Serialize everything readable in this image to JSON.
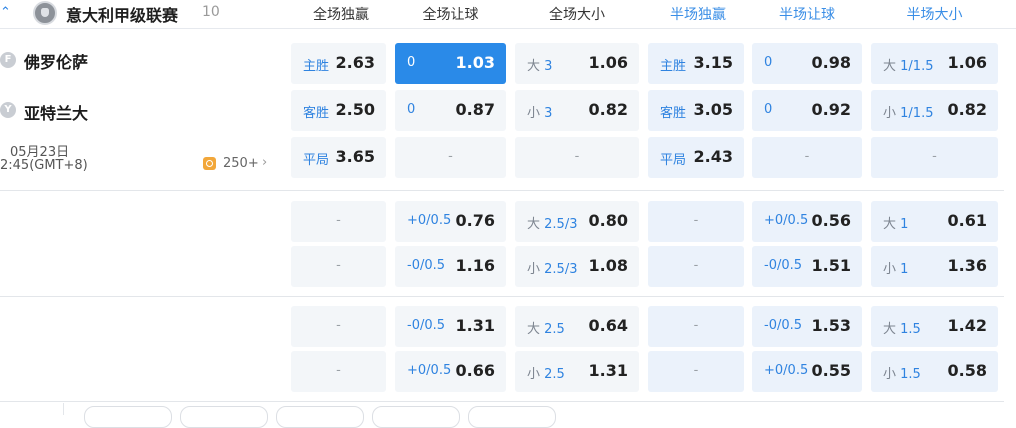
{
  "league": {
    "name": "意大利甲级联赛",
    "count": "10"
  },
  "columns": [
    {
      "label": "全场独赢",
      "color": "#333333"
    },
    {
      "label": "全场让球",
      "color": "#333333"
    },
    {
      "label": "全场大小",
      "color": "#333333"
    },
    {
      "label": "半场独赢",
      "color": "#3a8ee6"
    },
    {
      "label": "半场让球",
      "color": "#3a8ee6"
    },
    {
      "label": "半场大小",
      "color": "#3a8ee6"
    }
  ],
  "match": {
    "home": {
      "badge": "F",
      "name": "佛罗伦萨"
    },
    "away": {
      "badge": "Y",
      "name": "亚特兰大"
    },
    "date": "05月23日",
    "time": "2:45(GMT+8)",
    "more": "250+"
  },
  "rows": [
    [
      {
        "l": "主胜",
        "v": "2.63"
      },
      {
        "l": "0",
        "v": "1.03",
        "hl": true
      },
      {
        "l": "大 3",
        "v": "1.06"
      },
      {
        "l": "主胜",
        "v": "3.15"
      },
      {
        "l": "0",
        "v": "0.98"
      },
      {
        "l": "大 1/1.5",
        "v": "1.06"
      }
    ],
    [
      {
        "l": "客胜",
        "v": "2.50"
      },
      {
        "l": "0",
        "v": "0.87"
      },
      {
        "l": "小 3",
        "v": "0.82"
      },
      {
        "l": "客胜",
        "v": "3.05"
      },
      {
        "l": "0",
        "v": "0.92"
      },
      {
        "l": "小 1/1.5",
        "v": "0.82"
      }
    ],
    [
      {
        "d": "-"
      },
      {
        "d": "-"
      },
      {
        "d": "-"
      },
      {
        "l": "平局",
        "v": "2.43"
      },
      {
        "d": "-"
      },
      {
        "d": "-"
      }
    ],
    [
      {
        "d": "-"
      },
      {
        "l": "+0/0.5",
        "v": "0.76"
      },
      {
        "l": "大 2.5/3",
        "v": "0.80"
      },
      {
        "d": "-"
      },
      {
        "l": "+0/0.5",
        "v": "0.56"
      },
      {
        "l": "大 1",
        "v": "0.61"
      }
    ],
    [
      {
        "d": "-"
      },
      {
        "l": "-0/0.5",
        "v": "1.16"
      },
      {
        "l": "小 2.5/3",
        "v": "1.08"
      },
      {
        "d": "-"
      },
      {
        "l": "-0/0.5",
        "v": "1.51"
      },
      {
        "l": "小 1",
        "v": "1.36"
      }
    ],
    [
      {
        "d": "-"
      },
      {
        "l": "-0/0.5",
        "v": "1.31"
      },
      {
        "l": "大 2.5",
        "v": "0.64"
      },
      {
        "d": "-"
      },
      {
        "l": "-0/0.5",
        "v": "1.53"
      },
      {
        "l": "大 1.5",
        "v": "1.42"
      }
    ],
    [
      {
        "d": "-"
      },
      {
        "l": "+0/0.5",
        "v": "0.66"
      },
      {
        "l": "小 2.5",
        "v": "1.31"
      },
      {
        "d": "-"
      },
      {
        "l": "+0/0.5",
        "v": "0.55"
      },
      {
        "l": "小 1.5",
        "v": "0.58"
      }
    ]
  ],
  "draw_row_first": {
    "l": "平局",
    "v": "3.65"
  }
}
